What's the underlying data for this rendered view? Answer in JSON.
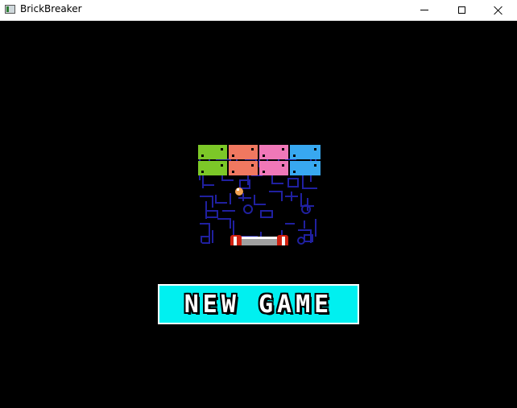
{
  "window": {
    "title": "BrickBreaker"
  },
  "menu": {
    "new_game_label": "NEW GAME"
  },
  "colors": {
    "background": "#000000",
    "button": "#00f0f0",
    "brick_green": "#7cc828",
    "brick_salmon": "#f07860",
    "brick_pink": "#f078b8",
    "brick_blue": "#38a8f0",
    "maze": "#2020a0",
    "paddle_red": "#d02010",
    "paddle_gray": "#a0a0a0",
    "ball": "#f0a050"
  },
  "icons": {
    "app": "window-icon",
    "minimize": "minimize-icon",
    "maximize": "maximize-icon",
    "close": "close-icon"
  }
}
